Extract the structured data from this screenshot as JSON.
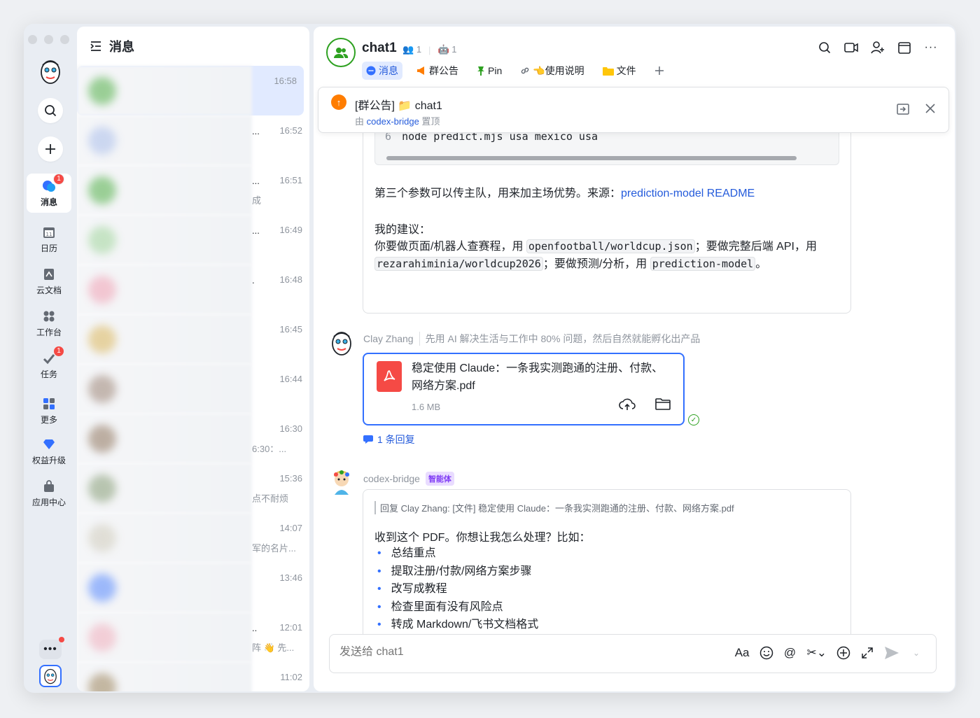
{
  "rail": {
    "nav": [
      {
        "label": "消息",
        "badge": "1",
        "active": true
      },
      {
        "label": "日历",
        "badge": "",
        "active": false
      },
      {
        "label": "云文档",
        "badge": "",
        "active": false
      },
      {
        "label": "工作台",
        "badge": "",
        "active": false
      },
      {
        "label": "任务",
        "badge": "1",
        "active": false
      },
      {
        "label": "更多",
        "badge": "",
        "active": false
      },
      {
        "label": "权益升级",
        "badge": "",
        "active": false
      },
      {
        "label": "应用中心",
        "badge": "",
        "active": false
      }
    ]
  },
  "list": {
    "title": "消息",
    "rows": [
      {
        "time": "16:58",
        "snippet": "",
        "ell": ""
      },
      {
        "time": "16:52",
        "snippet": "",
        "ell": "..."
      },
      {
        "time": "16:51",
        "snippet": "成",
        "ell": "..."
      },
      {
        "time": "16:49",
        "snippet": "",
        "ell": "..."
      },
      {
        "time": "16:48",
        "snippet": "",
        "ell": "."
      },
      {
        "time": "16:45",
        "snippet": "",
        "ell": ""
      },
      {
        "time": "16:44",
        "snippet": "",
        "ell": ""
      },
      {
        "time": "16:30",
        "snippet": "6:30：...",
        "ell": ""
      },
      {
        "time": "15:36",
        "snippet": "点不耐烦",
        "ell": ""
      },
      {
        "time": "14:07",
        "snippet": "军的名片...",
        "ell": ""
      },
      {
        "time": "13:46",
        "snippet": "",
        "ell": ""
      },
      {
        "time": "12:01",
        "snippet": "阵 👋 先...",
        "ell": ".."
      },
      {
        "time": "11:02",
        "snippet": "",
        "ell": ""
      }
    ]
  },
  "chat": {
    "title": "chat1",
    "members": "1",
    "bots": "1",
    "tabs": [
      {
        "label": "消息",
        "icon": "chat-bubble-icon",
        "active": true
      },
      {
        "label": "群公告",
        "icon": "megaphone-icon",
        "active": false
      },
      {
        "label": "Pin",
        "icon": "pin-icon",
        "active": false
      },
      {
        "label": "👈使用说明",
        "icon": "link-icon",
        "active": false
      },
      {
        "label": "文件",
        "icon": "folder-icon",
        "active": false
      }
    ],
    "pinned": {
      "title": "[群公告] 📁 chat1",
      "by_prefix": "由",
      "by_name": "codex-bridge",
      "by_suffix": "置顶"
    },
    "message1": {
      "code_line_no": "6",
      "code_text": "node predict.mjs usa mexico usa",
      "p1": "第三个参数可以传主队，用来加主场优势。来源：",
      "p1_link": "prediction-model README",
      "p2": "我的建议：",
      "p3a": "你要做页面/机器人查赛程，用 ",
      "code1": "openfootball/worldcup.json",
      "p3b": "；要做完整后端 API，用 ",
      "code2": "rezarahiminia/worldcup2026",
      "p3c": "；要做预测/分析，用 ",
      "code3": "prediction-model",
      "p3d": "。"
    },
    "message2": {
      "sender": "Clay Zhang",
      "signature": "先用 AI 解决生活与工作中 80% 问题，然后自然就能孵化出产品",
      "file_name": "稳定使用 Claude：一条我实测跑通的注册、付款、网络方案.pdf",
      "file_size": "1.6 MB",
      "reply_count": "1 条回复"
    },
    "message3": {
      "sender": "codex-bridge",
      "tag": "智能体",
      "quote": "回复 Clay Zhang: [文件] 稳定使用 Claude：一条我实测跑通的注册、付款、网络方案.pdf",
      "intro": "收到这个 PDF。你想让我怎么处理？比如：",
      "items": [
        "总结重点",
        "提取注册/付款/网络方案步骤",
        "改写成教程",
        "检查里面有没有风险点",
        "转成 Markdown/飞书文档格式"
      ]
    },
    "composer": {
      "placeholder": "发送给 chat1"
    }
  },
  "colors": {
    "accent": "#3370ff",
    "badge": "#f54a45",
    "active_tab_bg": "#e1eaff"
  }
}
